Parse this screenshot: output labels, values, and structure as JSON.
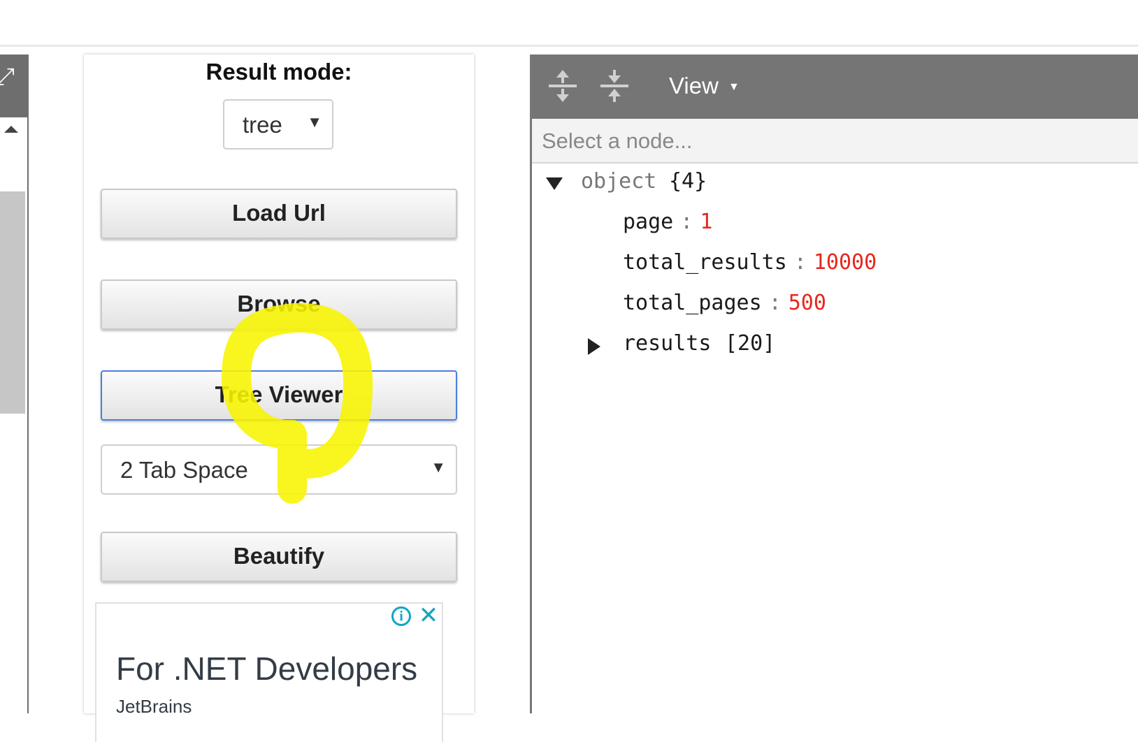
{
  "middle_panel": {
    "result_mode_label": "Result mode:",
    "result_mode_value": "tree",
    "buttons": {
      "load_url": "Load Url",
      "browse": "Browse",
      "tree_viewer": "Tree Viewer",
      "beautify": "Beautify"
    },
    "indent_select_value": "2 Tab Space",
    "ad": {
      "headline": "For .NET Developers",
      "brand": "JetBrains",
      "info_icon": "i",
      "close_icon": "✕"
    }
  },
  "tree_panel": {
    "menu": {
      "view_label": "View",
      "view_caret": "▼"
    },
    "navbar_placeholder": "Select a node...",
    "root": {
      "key": "object",
      "count": "{4}"
    },
    "fields": [
      {
        "key": "page",
        "sep": ":",
        "value": "1"
      },
      {
        "key": "total_results",
        "sep": ":",
        "value": "10000"
      },
      {
        "key": "total_pages",
        "sep": ":",
        "value": "500"
      }
    ],
    "results": {
      "key": "results",
      "count": "[20]"
    }
  },
  "icons": {
    "left_menu": "expand-icon",
    "scroll": "scroll-up-arrow-icon",
    "expand_all": "expand-all-icon",
    "collapse_all": "collapse-all-icon"
  },
  "colors": {
    "menu_bar": "#757575",
    "value_red": "#e8271e",
    "focus_blue": "#4a7fe0",
    "highlight_yellow": "#f8f400",
    "ad_accent": "#11a6c3"
  }
}
